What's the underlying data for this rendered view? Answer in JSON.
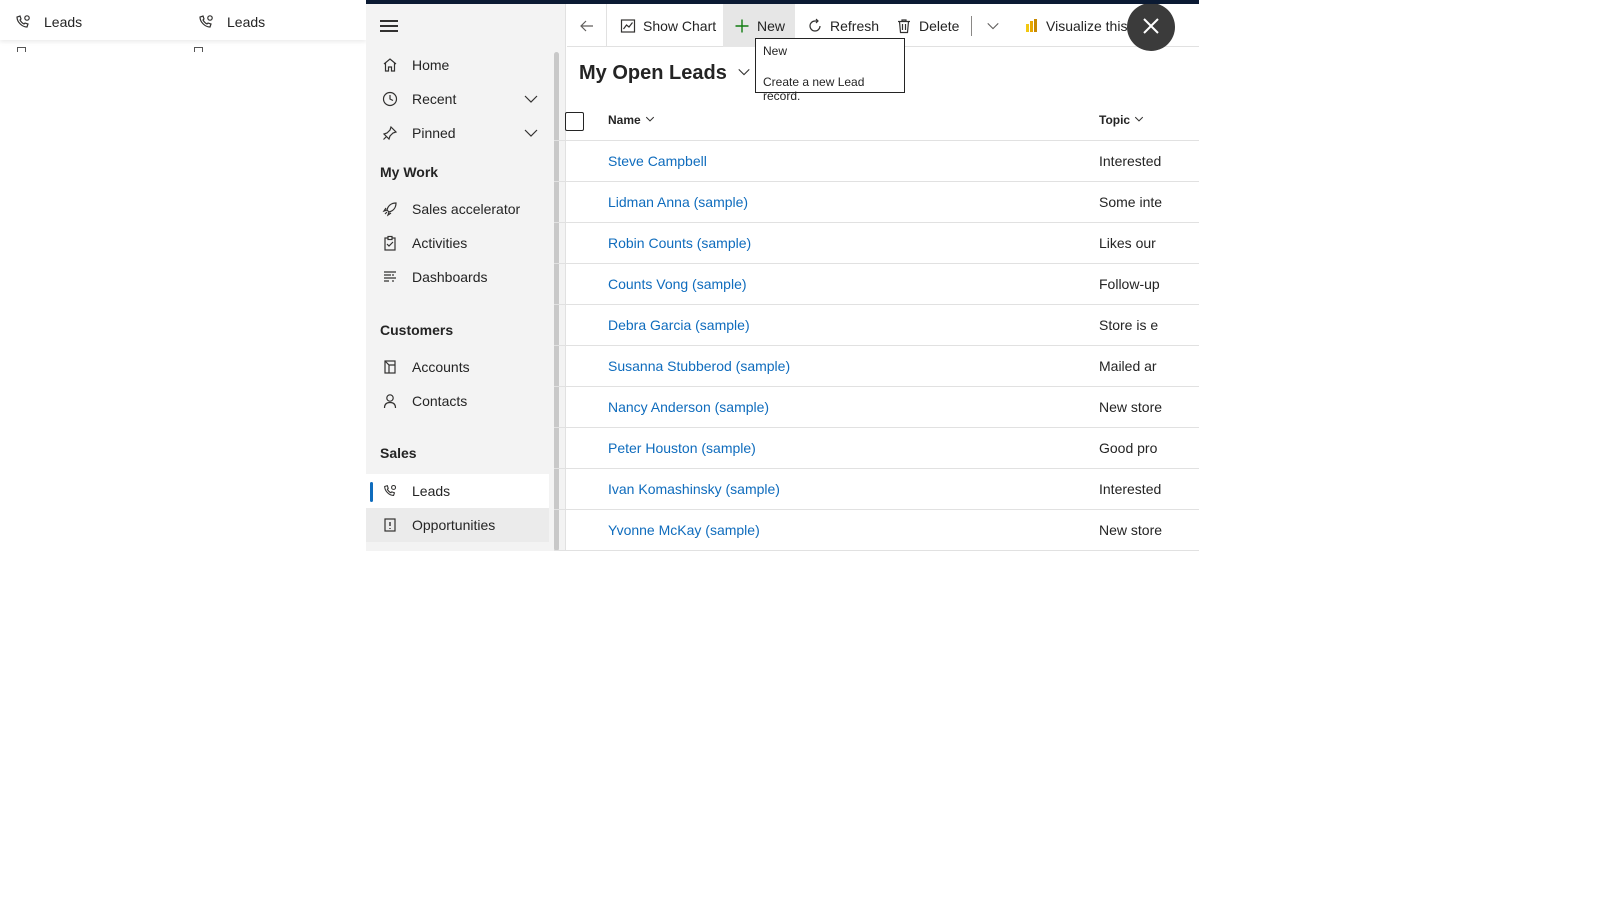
{
  "background": {
    "tabs": [
      {
        "label": "Leads",
        "icon": "leads-icon"
      },
      {
        "label": "Leads",
        "icon": "leads-icon"
      }
    ]
  },
  "sidebar": {
    "items_top": [
      {
        "label": "Home",
        "icon": "home-icon"
      },
      {
        "label": "Recent",
        "icon": "clock-icon",
        "expandable": true
      },
      {
        "label": "Pinned",
        "icon": "pin-icon",
        "expandable": true
      }
    ],
    "groups": [
      {
        "title": "My Work",
        "items": [
          {
            "label": "Sales accelerator",
            "icon": "rocket-icon"
          },
          {
            "label": "Activities",
            "icon": "clipboard-icon"
          },
          {
            "label": "Dashboards",
            "icon": "dashboard-icon"
          }
        ]
      },
      {
        "title": "Customers",
        "items": [
          {
            "label": "Accounts",
            "icon": "building-icon"
          },
          {
            "label": "Contacts",
            "icon": "person-icon"
          }
        ]
      },
      {
        "title": "Sales",
        "items": [
          {
            "label": "Leads",
            "icon": "leads-icon",
            "active": true
          },
          {
            "label": "Opportunities",
            "icon": "opportunity-icon"
          }
        ]
      }
    ]
  },
  "commandbar": {
    "show_chart": "Show Chart",
    "new": "New",
    "refresh": "Refresh",
    "delete": "Delete",
    "visualize": "Visualize this view"
  },
  "tooltip": {
    "title": "New",
    "description": "Create a new Lead record."
  },
  "view": {
    "title": "My Open Leads"
  },
  "grid": {
    "columns": [
      "Name",
      "Topic"
    ],
    "rows": [
      {
        "name": "Steve Campbell",
        "topic": "Interested"
      },
      {
        "name": "Lidman Anna (sample)",
        "topic": "Some inte"
      },
      {
        "name": "Robin Counts (sample)",
        "topic": "Likes our"
      },
      {
        "name": "Counts Vong (sample)",
        "topic": "Follow-up"
      },
      {
        "name": "Debra Garcia (sample)",
        "topic": "Store is e"
      },
      {
        "name": "Susanna Stubberod (sample)",
        "topic": "Mailed ar"
      },
      {
        "name": "Nancy Anderson (sample)",
        "topic": "New store"
      },
      {
        "name": "Peter Houston (sample)",
        "topic": "Good pro"
      },
      {
        "name": "Ivan Komashinsky (sample)",
        "topic": "Interested"
      },
      {
        "name": "Yvonne McKay (sample)",
        "topic": "New store"
      }
    ]
  },
  "colors": {
    "accent": "#0f6cbd",
    "topbar": "#0b1a33",
    "sidebar_bg": "#f3f3f3",
    "close_button": "#3b3b3b"
  }
}
